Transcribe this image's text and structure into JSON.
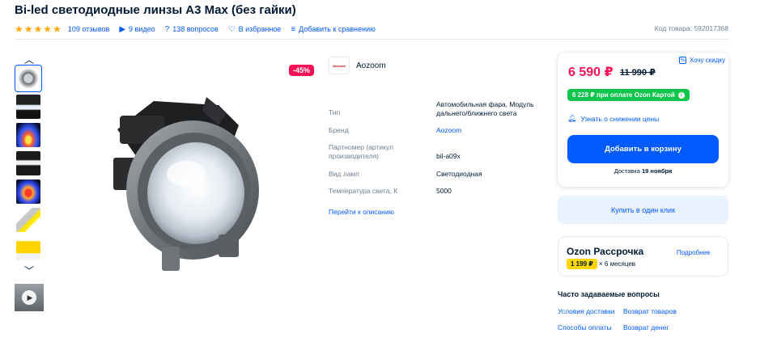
{
  "product": {
    "title": "Bi-led светодиодные линзы A3 Max (без гайки)",
    "reviews": "109 отзывов",
    "videos": "9 видео",
    "questions": "138 вопросов",
    "favorites": "В избранное",
    "compare": "Добавить к сравнению",
    "code": "Код товара: 592017368",
    "rating_stars": 5
  },
  "gallery": {
    "up_arrow_icon": "chevron-up-icon",
    "down_arrow_icon": "chevron-down-icon",
    "thumbnail_count": 7,
    "active_index": 0,
    "video_icon": "play-icon"
  },
  "badge": "-45%",
  "brand": {
    "logo_text": "Aozoom",
    "name": "Aozoom"
  },
  "specs": [
    {
      "key": "Тип",
      "value": "Автомобильная фара, Модуль дальнего/ближнего света"
    },
    {
      "key": "Бренд",
      "value": "Aozoom"
    },
    {
      "key": "Партномер (артикул производителя)",
      "value": "bil-a09x"
    },
    {
      "key": "Вид ламп",
      "value": "Светодиодная"
    },
    {
      "key": "Температура света, К",
      "value": "5000"
    }
  ],
  "description_link": "Перейти к описанию",
  "purchase": {
    "price": "6 590 ₽",
    "old_price": "11 990 ₽",
    "discount_link": "Хочу скидку",
    "ozon_card_price": "6 228 ₽ при оплате Ozon Картой",
    "notify": "Узнать о снижении цены",
    "add_to_cart": "Добавить в корзину",
    "delivery_prefix": "Доставка",
    "delivery_date": "19 ноября",
    "one_click": "Купить в один клик"
  },
  "installment": {
    "title": "Ozon Рассрочка",
    "more": "Подробнее",
    "amount": "1 199 ₽",
    "months": "× 6 месяцев"
  },
  "faq": {
    "title": "Часто задаваемые вопросы",
    "links": [
      "Условия доставки",
      "Возврат товаров",
      "Способы оплаты",
      "Возврат денег"
    ]
  },
  "colors": {
    "accent": "#005bff",
    "price": "#f91155",
    "green": "#10c44c",
    "star": "#ffa800"
  }
}
